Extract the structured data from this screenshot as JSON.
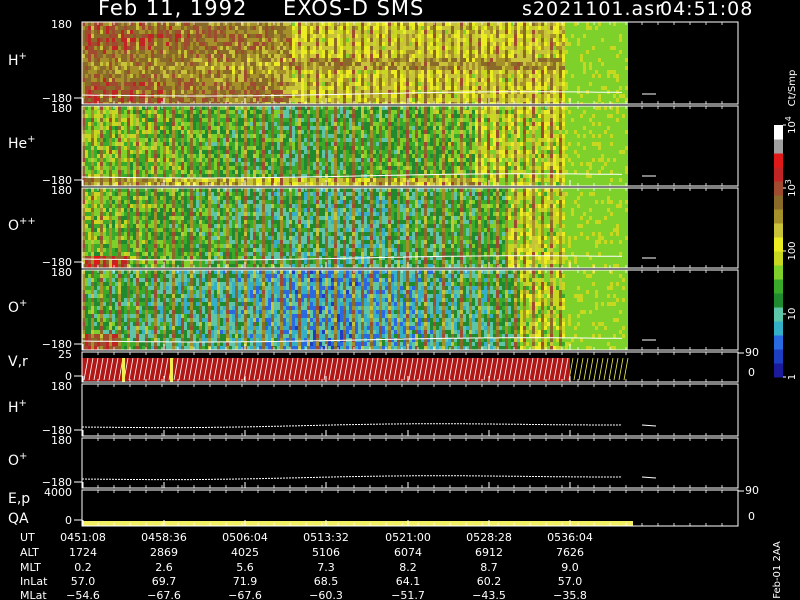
{
  "header": {
    "date": "Feb 11, 1992",
    "instrument": "EXOS-D SMS",
    "file": "s2021101.asr",
    "time": "04:51:08"
  },
  "colors": {
    "axis": "#ffffff",
    "background": "#000000",
    "trace": "#ffffff",
    "qa_bar": "#f4f064"
  },
  "chart_data": {
    "type": "heatmap",
    "panels": [
      {
        "name": "H",
        "sup": "+",
        "ytop": "180",
        "ybot": "−180",
        "kind": "spec",
        "style": "h"
      },
      {
        "name": "He",
        "sup": "+",
        "ytop": "180",
        "ybot": "−180",
        "kind": "spec",
        "style": "he"
      },
      {
        "name": "O",
        "sup": "++",
        "ytop": "180",
        "ybot": "−180",
        "kind": "spec",
        "style": "opp"
      },
      {
        "name": "O",
        "sup": "+",
        "ytop": "180",
        "ybot": "−180",
        "kind": "spec",
        "style": "op"
      },
      {
        "name": "V,r",
        "sup": "",
        "ytop": "25",
        "ybot": "0",
        "kind": "vr",
        "right_top": "90",
        "right_bot": "0"
      },
      {
        "name": "H",
        "sup": "+",
        "ytop": "180",
        "ybot": "−180",
        "kind": "empty"
      },
      {
        "name": "O",
        "sup": "+",
        "ytop": "180",
        "ybot": "−180",
        "kind": "empty"
      },
      {
        "name": "E,p",
        "sup": "",
        "name2": "QA",
        "ytop": "4000",
        "ybot": "0",
        "kind": "qa",
        "right_top": "90",
        "right_bot": "0"
      }
    ],
    "colorbar": {
      "unit": "Ct/Smp",
      "labels": [
        {
          "base": "1",
          "exp": "",
          "frac": 0.0
        },
        {
          "base": "10",
          "exp": "",
          "frac": 0.25
        },
        {
          "base": "100",
          "exp": "",
          "frac": 0.5
        },
        {
          "base": "10",
          "exp": "3",
          "frac": 0.75
        },
        {
          "base": "10",
          "exp": "4",
          "frac": 1.0
        }
      ],
      "colors": [
        "#1a1a9a",
        "#1d3ec0",
        "#2a6ae0",
        "#33b0c8",
        "#5ec6a8",
        "#1f8a2e",
        "#3aaa2a",
        "#7ed02a",
        "#c8d820",
        "#ecec22",
        "#c9c33a",
        "#a6902a",
        "#8a6a28",
        "#a04a30",
        "#c02424",
        "#e01818",
        "#a0a0a0",
        "#ffffff"
      ]
    },
    "time_axis": {
      "ticks": [
        "0451:08",
        "0458:36",
        "0506:04",
        "0513:32",
        "0521:00",
        "0528:28",
        "0536:04"
      ],
      "data_end_frac": 0.83
    },
    "ephemeris": [
      {
        "label": "UT",
        "values": [
          "0451:08",
          "0458:36",
          "0506:04",
          "0513:32",
          "0521:00",
          "0528:28",
          "0536:04"
        ]
      },
      {
        "label": "ALT",
        "values": [
          "1724",
          "2869",
          "4025",
          "5106",
          "6074",
          "6912",
          "7626"
        ]
      },
      {
        "label": "MLT",
        "values": [
          "0.2",
          "2.6",
          "5.6",
          "7.3",
          "8.2",
          "8.7",
          "9.0"
        ]
      },
      {
        "label": "InLat",
        "values": [
          "57.0",
          "69.7",
          "71.9",
          "68.5",
          "64.1",
          "60.2",
          "57.0"
        ]
      },
      {
        "label": "MLat",
        "values": [
          "−54.6",
          "−67.6",
          "−67.6",
          "−60.3",
          "−51.7",
          "−43.5",
          "−35.8"
        ]
      }
    ],
    "side_label": "Feb-01 2AA"
  }
}
